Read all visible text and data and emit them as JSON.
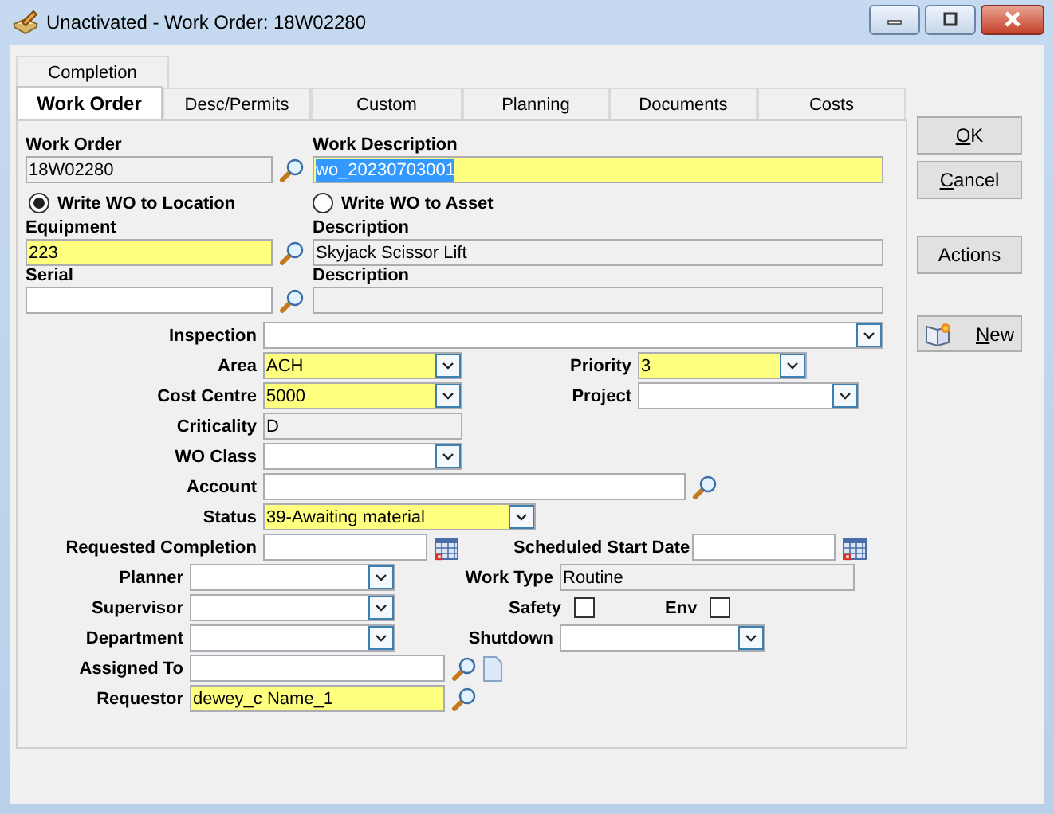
{
  "window": {
    "title": "Unactivated - Work Order: 18W02280"
  },
  "tab_rows": [
    [
      {
        "label": "Completion",
        "selected": false
      }
    ],
    [
      {
        "label": "Work Order",
        "selected": true
      },
      {
        "label": "Desc/Permits",
        "selected": false
      },
      {
        "label": "Custom",
        "selected": false
      },
      {
        "label": "Planning",
        "selected": false
      },
      {
        "label": "Documents",
        "selected": false
      },
      {
        "label": "Costs",
        "selected": false
      }
    ]
  ],
  "header_rows": [
    [
      {
        "label": "Work Order",
        "kind": "lookup",
        "required": false,
        "readonly": true,
        "value": "18W02280",
        "highlighted": false
      },
      {
        "label": "Work Description",
        "kind": "text",
        "required": true,
        "readonly": false,
        "value": "wo_20230703001",
        "highlighted": true
      }
    ],
    [
      {
        "label": "Equipment",
        "kind": "lookup",
        "required": true,
        "readonly": false,
        "value": "223",
        "highlighted": false
      },
      {
        "label": "Description",
        "kind": "text",
        "required": false,
        "readonly": true,
        "value": "Skyjack Scissor Lift",
        "highlighted": false
      }
    ],
    [
      {
        "label": "Serial",
        "kind": "lookup",
        "required": false,
        "readonly": false
      },
      {
        "label": "Description",
        "kind": "text",
        "required": false,
        "readonly": true
      }
    ]
  ],
  "radios": [
    {
      "label": "Write WO to Location",
      "selected": true
    },
    {
      "label": "Write WO to Asset",
      "selected": false
    }
  ],
  "detail_rows": [
    {
      "left": {
        "label": "Inspection",
        "kind": "dropdown",
        "required": false,
        "readonly": false
      }
    },
    {
      "left": {
        "label": "Area",
        "kind": "dropdown",
        "required": true,
        "readonly": false,
        "value": "ACH"
      },
      "right": {
        "label": "Priority",
        "kind": "dropdown",
        "required": true,
        "readonly": false,
        "value": "3"
      }
    },
    {
      "left": {
        "label": "Cost Centre",
        "kind": "dropdown",
        "required": true,
        "readonly": false,
        "value": "5000"
      },
      "right": {
        "label": "Project",
        "kind": "dropdown",
        "required": false,
        "readonly": false
      }
    },
    {
      "left": {
        "label": "Criticality",
        "kind": "text",
        "required": false,
        "readonly": true,
        "value": "D"
      }
    },
    {
      "left": {
        "label": "WO Class",
        "kind": "dropdown",
        "required": false,
        "readonly": false
      }
    },
    {
      "left": {
        "label": "Account",
        "kind": "lookup",
        "required": false,
        "readonly": false
      }
    },
    {
      "left": {
        "label": "Status",
        "kind": "dropdown",
        "required": true,
        "readonly": false,
        "value": "39-Awaiting material"
      }
    },
    {
      "left": {
        "label": "Requested Completion",
        "kind": "date",
        "required": false,
        "readonly": false
      },
      "right": {
        "label": "Scheduled Start Date",
        "kind": "date",
        "required": false,
        "readonly": false
      }
    }
  ],
  "people_rows": [
    {
      "left": {
        "label": "Planner",
        "kind": "dropdown",
        "required": false,
        "readonly": false
      },
      "right": {
        "label": "Work Type",
        "kind": "text",
        "required": false,
        "readonly": true,
        "value": "Routine"
      }
    },
    {
      "left": {
        "label": "Supervisor",
        "kind": "dropdown",
        "required": false,
        "readonly": false
      },
      "right": {
        "kind": "checks",
        "items": [
          {
            "label": "Safety",
            "checked": false
          },
          {
            "label": "Env",
            "checked": false
          }
        ]
      }
    },
    {
      "left": {
        "label": "Department",
        "kind": "dropdown",
        "required": false,
        "readonly": false
      },
      "right": {
        "label": "Shutdown",
        "kind": "dropdown",
        "required": false,
        "readonly": false
      }
    },
    {
      "left": {
        "label": "Assigned To",
        "kind": "attachment",
        "required": false,
        "readonly": false
      }
    },
    {
      "left": {
        "label": "Requestor",
        "kind": "lookup",
        "required": true,
        "readonly": false,
        "value": "dewey_c Name_1"
      }
    }
  ],
  "buttons": [
    {
      "label": "OK",
      "mnemonic": true,
      "kind": "plain"
    },
    {
      "label": "Cancel",
      "mnemonic": true,
      "kind": "plain"
    },
    {
      "label": "Actions",
      "mnemonic": false,
      "kind": "plain"
    },
    {
      "label": "New",
      "mnemonic": true,
      "kind": "new"
    }
  ]
}
